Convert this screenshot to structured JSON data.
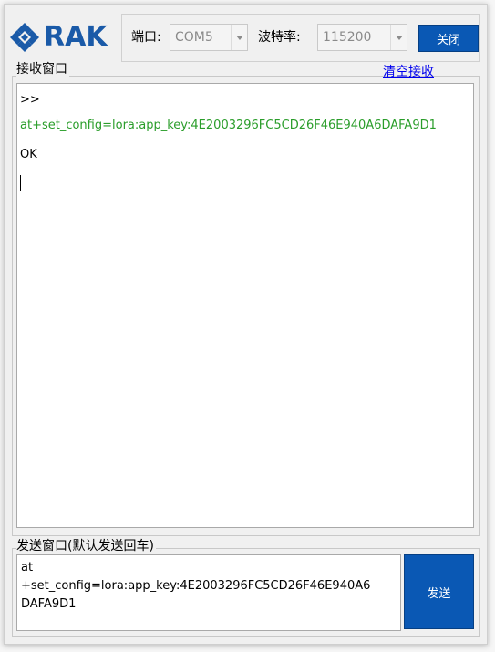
{
  "brand": {
    "name": "RAK",
    "color": "#1a5aa8"
  },
  "connection": {
    "port_label": "端口:",
    "port_value": "COM5",
    "baud_label": "波特率:",
    "baud_value": "115200",
    "close_button": "关闭"
  },
  "receive": {
    "title": "接收窗口",
    "clear_link": "清空接收",
    "lines": [
      {
        "text": ">>",
        "color": "#000000"
      },
      {
        "text": "at+set_config=lora:app_key:4E2003296FC5CD26F46E940A6DAFA9D1",
        "color": "#2a9d2a"
      },
      {
        "text": "OK",
        "color": "#000000"
      }
    ]
  },
  "send": {
    "title": "发送窗口(默认发送回车)",
    "input_value": "at\n+set_config=lora:app_key:4E2003296FC5CD26F46E940A6\nDAFA9D1",
    "send_button": "发送"
  },
  "colors": {
    "accent_button": "#0a58b4",
    "link": "#0000ee",
    "command_echo": "#2a9d2a"
  }
}
